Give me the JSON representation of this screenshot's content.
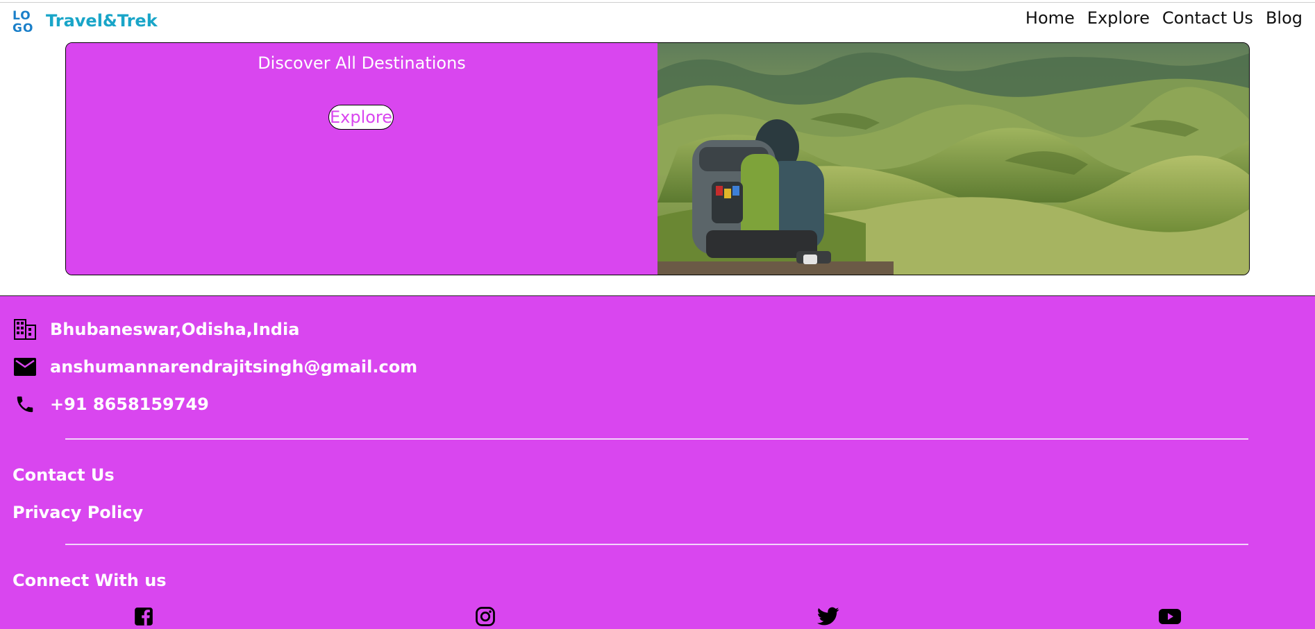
{
  "header": {
    "logo_top": "LO",
    "logo_bottom": "GO",
    "brand": "Travel&Trek",
    "nav": [
      "Home",
      "Explore",
      "Contact Us",
      "Blog"
    ]
  },
  "hero": {
    "title": "Discover All Destinations",
    "button_label": "Explore",
    "image": "backpacker-on-green-hills"
  },
  "footer": {
    "address": "Bhubaneswar,Odisha,India",
    "email": "anshumannarendrajitsingh@gmail.com",
    "phone": "+91 8658159749",
    "links": [
      "Contact Us",
      "Privacy Policy"
    ],
    "connect_title": "Connect With us",
    "social_icons": [
      "facebook-icon",
      "instagram-icon",
      "twitter-icon",
      "youtube-icon"
    ]
  },
  "colors": {
    "accent": "#d946ef",
    "brand": "#19a5c8",
    "logo": "#1a7fc9"
  }
}
